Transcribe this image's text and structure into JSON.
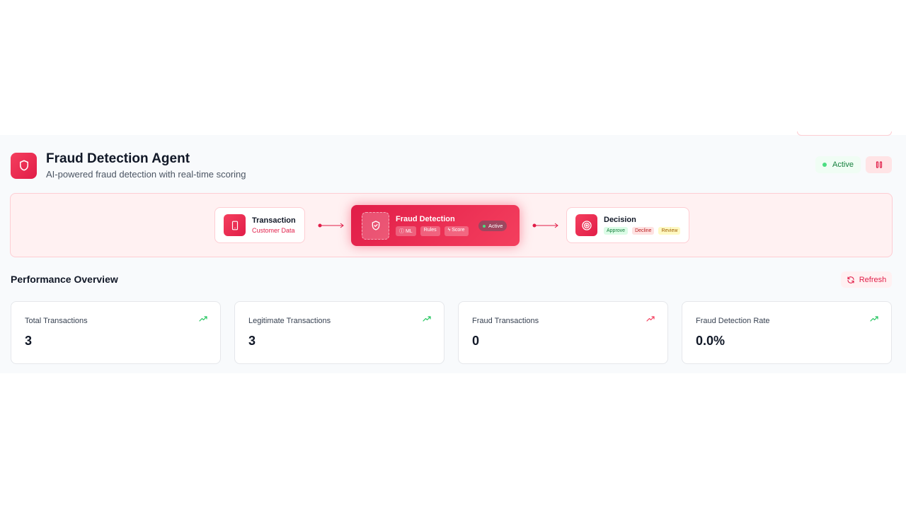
{
  "header": {
    "title": "Fraud Detection Agent",
    "subtitle": "AI-powered fraud detection with real-time scoring",
    "status": "Active"
  },
  "pipeline": {
    "transaction": {
      "title": "Transaction",
      "subtitle": "Customer Data"
    },
    "fraud_detection": {
      "title": "Fraud Detection",
      "chips": [
        "ML",
        "Rules",
        "Score"
      ],
      "status": "Active"
    },
    "decision": {
      "title": "Decision",
      "tags": [
        "Approve",
        "Decline",
        "Review"
      ]
    }
  },
  "performance": {
    "title": "Performance Overview",
    "refresh_label": "Refresh",
    "stats": [
      {
        "label": "Total Transactions",
        "value": "3",
        "trend_color": "#22c55e"
      },
      {
        "label": "Legitimate Transactions",
        "value": "3",
        "trend_color": "#22c55e"
      },
      {
        "label": "Fraud Transactions",
        "value": "0",
        "trend_color": "#f43f5e"
      },
      {
        "label": "Fraud Detection Rate",
        "value": "0.0%",
        "trend_color": "#22c55e"
      }
    ]
  },
  "colors": {
    "accent": "#e11d48",
    "success": "#22c55e"
  }
}
